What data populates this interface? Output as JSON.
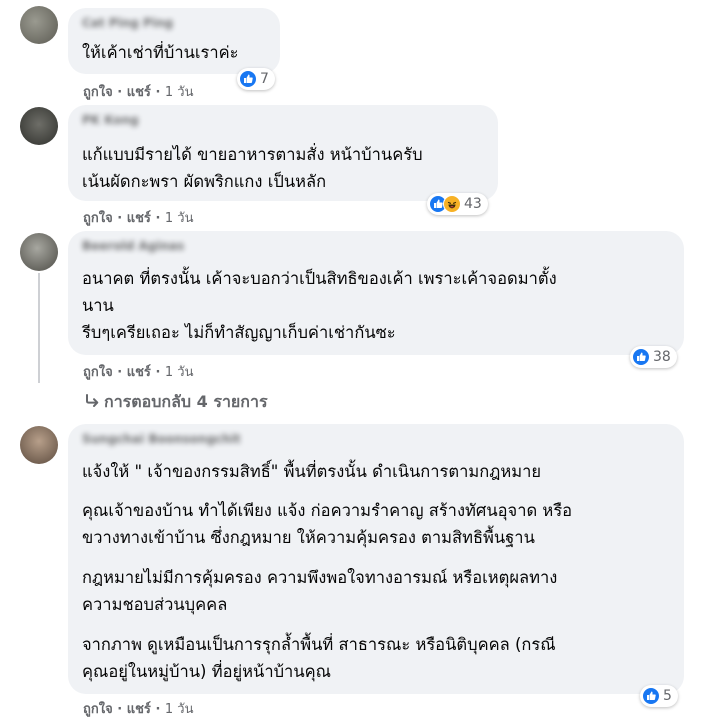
{
  "comments": [
    {
      "author": "Cat Ping Ping",
      "lines": [
        "ให้เค้าเช่าที่บ้านเราค่ะ"
      ],
      "reaction_count": "7",
      "actions": {
        "like": "ถูกใจ",
        "share": "แชร์",
        "time": "1 วัน"
      }
    },
    {
      "author": "PK Kong",
      "lines": [
        "แก้แบบมีรายได้ ขายอาหารตามสั่ง หน้าบ้านครับ",
        "เน้นผัดกะพรา ผัดพริกแกง เป็นหลัก"
      ],
      "reaction_count": "43",
      "actions": {
        "like": "ถูกใจ",
        "share": "แชร์",
        "time": "1 วัน"
      }
    },
    {
      "author": "Beerold Aginas",
      "lines": [
        "อนาคต ที่ตรงนั้น เค้าจะบอกว่าเป็นสิทธิของเค้า เพราะเค้าจอดมาตั้ง",
        "นาน",
        "รีบๆเครียเถอะ ไม่ก็ทำสัญญาเก็บค่าเช่ากันซะ"
      ],
      "reaction_count": "38",
      "actions": {
        "like": "ถูกใจ",
        "share": "แชร์",
        "time": "1 วัน"
      },
      "replies_link": "การตอบกลับ 4 รายการ"
    },
    {
      "author": "Sungchai Boonsongchit",
      "paragraphs": [
        [
          "แจ้งให้ \" เจ้าของกรรมสิทธิ์\" พื้นที่ตรงนั้น ดำเนินการตามกฎหมาย"
        ],
        [
          "คุณเจ้าของบ้าน ทำได้เพียง แจ้ง ก่อความรำคาญ สร้างทัศนอุจาด หรือ",
          "ขวางทางเข้าบ้าน ซึ่งกฎหมาย ให้ความคุ้มครอง ตามสิทธิพื้นฐาน"
        ],
        [
          "กฎหมายไม่มีการคุ้มครอง ความพึงพอใจทางอารมณ์ หรือเหตุผลทาง",
          "ความชอบส่วนบุคคล"
        ],
        [
          "จากภาพ ดูเหมือนเป็นการรุกล้ำพื้นที่ สาธารณะ หรือนิติบุคคล (กรณี",
          "คุณอยู่ในหมู่บ้าน) ที่อยู่หน้าบ้านคุณ"
        ]
      ],
      "reaction_count": "5",
      "actions": {
        "like": "ถูกใจ",
        "share": "แชร์",
        "time": "1 วัน"
      }
    }
  ],
  "icons": {
    "like": "like-icon",
    "haha": "haha-icon",
    "reply_arrow": "reply-arrow-icon"
  },
  "colors": {
    "like_blue": "#1877f2",
    "bubble_bg": "#f0f2f5",
    "meta_gray": "#65676b"
  }
}
